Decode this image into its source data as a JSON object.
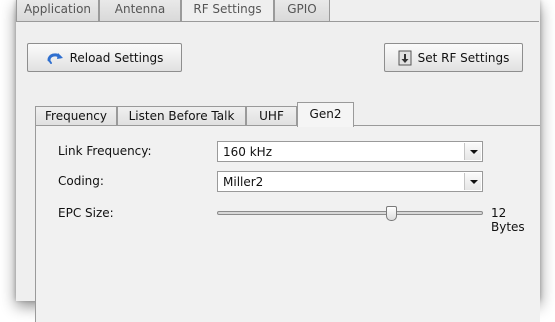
{
  "top_tabs": [
    {
      "label": "Application"
    },
    {
      "label": "Antenna"
    },
    {
      "label": "RF Settings",
      "selected": true
    },
    {
      "label": "GPIO"
    }
  ],
  "buttons": {
    "reload": {
      "label": "Reload Settings",
      "icon": "reload-icon"
    },
    "set_rf": {
      "label": "Set RF Settings",
      "icon": "download-icon"
    }
  },
  "inner_tabs": [
    {
      "label": "Frequency"
    },
    {
      "label": "Listen Before Talk"
    },
    {
      "label": "UHF"
    },
    {
      "label": "Gen2",
      "selected": true
    }
  ],
  "gen2": {
    "link_frequency": {
      "label": "Link Frequency:",
      "value": "160 kHz"
    },
    "coding": {
      "label": "Coding:",
      "value": "Miller2"
    },
    "epc_size": {
      "label": "EPC Size:",
      "value_text": "12 Bytes",
      "slider_fraction": 0.66
    }
  },
  "colors": {
    "accent": "#3a7bd5"
  }
}
